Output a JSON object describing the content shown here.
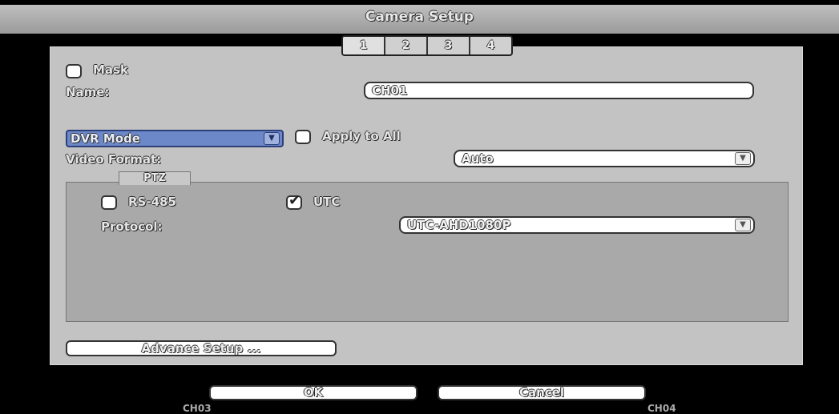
{
  "window": {
    "title": "Camera Setup"
  },
  "tabs": [
    "1",
    "2",
    "3",
    "4"
  ],
  "mask": {
    "label": "Mask",
    "checked": false
  },
  "name": {
    "label": "Name:",
    "value": "CH01"
  },
  "mode": {
    "value": "DVR Mode"
  },
  "apply_all": {
    "label": "Apply to All",
    "checked": false
  },
  "video_format": {
    "label": "Video Format:",
    "value": "Auto"
  },
  "ptz": {
    "tab_label": "PTZ",
    "rs485": {
      "label": "RS-485",
      "checked": false
    },
    "utc": {
      "label": "UTC",
      "checked": true
    },
    "protocol": {
      "label": "Protocol:",
      "value": "UTC-AHD1080P"
    }
  },
  "buttons": {
    "advance": "Advance Setup ...",
    "ok": "OK",
    "cancel": "Cancel"
  },
  "background": {
    "left_peek": "CH03",
    "right_peek": "CH04"
  },
  "colors": {
    "accent": "#6d88c8",
    "panel": "#c3c3c3",
    "ptz_panel": "#a9a9a9"
  }
}
